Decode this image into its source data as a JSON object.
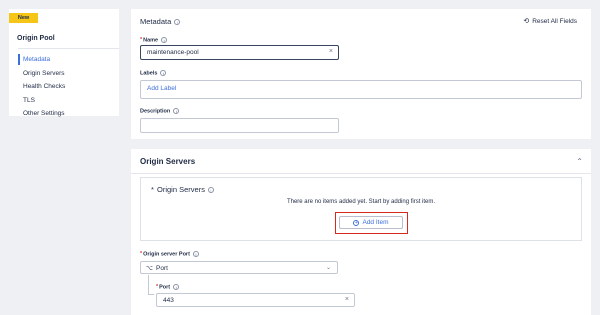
{
  "sidebar": {
    "badge": "New",
    "title": "Origin Pool",
    "items": [
      {
        "label": "Metadata"
      },
      {
        "label": "Origin Servers"
      },
      {
        "label": "Health Checks"
      },
      {
        "label": "TLS"
      },
      {
        "label": "Other Settings"
      }
    ]
  },
  "metadata": {
    "title": "Metadata",
    "reset_label": "Reset All Fields",
    "name_label": "Name",
    "name_value": "maintenance-pool",
    "labels_label": "Labels",
    "add_label": "Add Label",
    "description_label": "Description",
    "description_value": ""
  },
  "origin_servers": {
    "section_title": "Origin Servers",
    "list_label": "Origin Servers",
    "empty_message": "There are no items added yet. Start by adding first item.",
    "add_item_label": "Add Item",
    "port_label": "Origin server Port",
    "port_select_value": "Port",
    "port_field_label": "Port",
    "port_value": "443"
  },
  "colors": {
    "accent": "#3b6fd9",
    "badge": "#f5c518",
    "highlight": "#d52b1e"
  }
}
